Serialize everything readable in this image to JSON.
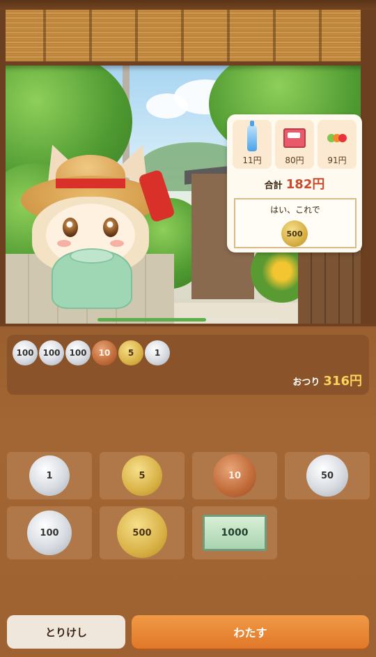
{
  "order": {
    "items": [
      {
        "icon": "ramune-bottle-icon",
        "price": "11円"
      },
      {
        "icon": "snack-box-icon",
        "price": "80円"
      },
      {
        "icon": "jelly-cups-icon",
        "price": "91円"
      }
    ],
    "total_label": "合計",
    "total_value": "182円",
    "pay_text": "はい、これで",
    "pay_coin": "500"
  },
  "scene": {
    "progress_fraction": 0.6
  },
  "tray": {
    "coins": [
      {
        "value": "100",
        "kind": "silver"
      },
      {
        "value": "100",
        "kind": "silver"
      },
      {
        "value": "100",
        "kind": "silver"
      },
      {
        "value": "10",
        "kind": "copper"
      },
      {
        "value": "5",
        "kind": "gold"
      },
      {
        "value": "1",
        "kind": "silver"
      }
    ],
    "change_label": "おつり",
    "change_value": "316円"
  },
  "money_buttons": [
    {
      "label": "1",
      "kind": "silver"
    },
    {
      "label": "5",
      "kind": "gold"
    },
    {
      "label": "10",
      "kind": "copper"
    },
    {
      "label": "50",
      "kind": "silver"
    },
    {
      "label": "100",
      "kind": "silver"
    },
    {
      "label": "500",
      "kind": "gold"
    },
    {
      "label": "1000",
      "kind": "bill"
    }
  ],
  "actions": {
    "cancel": "とりけし",
    "give": "わたす"
  },
  "colors": {
    "panel": "#9e6232",
    "give_button": "#e8842f",
    "total_value": "#c8492b",
    "change_value": "#ffd45a"
  }
}
